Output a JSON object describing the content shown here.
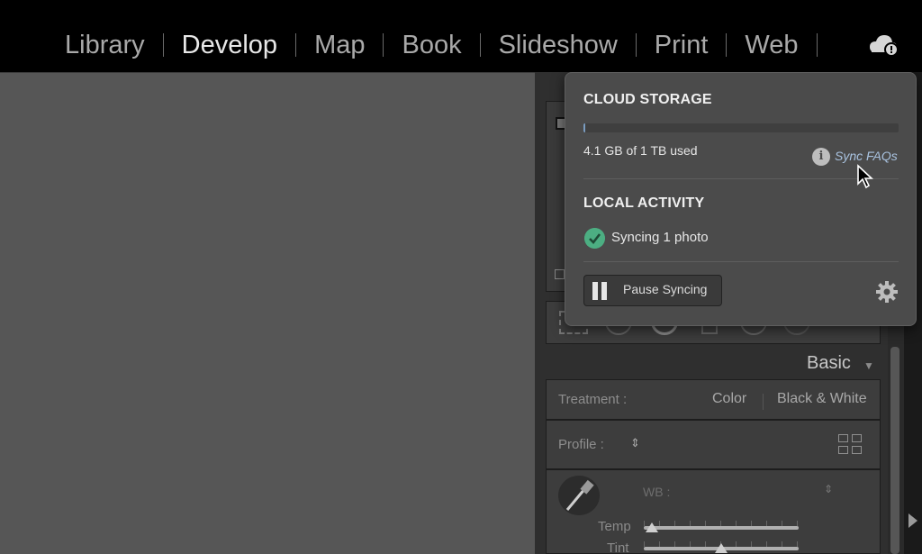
{
  "modules": {
    "items": [
      {
        "label": "Library"
      },
      {
        "label": "Develop"
      },
      {
        "label": "Map"
      },
      {
        "label": "Book"
      },
      {
        "label": "Slideshow"
      },
      {
        "label": "Print"
      },
      {
        "label": "Web"
      }
    ],
    "active": "Develop",
    "cloud_icon": "cloud-sync-icon"
  },
  "cloud_popup": {
    "storage_title": "CLOUD STORAGE",
    "usage_text": "4.1 GB of 1 TB used",
    "usage_fraction": 0.0041,
    "faq_link": "Sync FAQs",
    "activity_title": "LOCAL ACTIVITY",
    "sync_status": "Syncing 1 photo",
    "pause_button": "Pause Syncing",
    "icons": {
      "info": "info-icon",
      "status": "check-circle-icon",
      "pause": "pause-icon",
      "settings": "gear-icon"
    },
    "colors": {
      "status_green": "#4cae82",
      "link_blue": "#a9c3e0"
    }
  },
  "develop_panel": {
    "section_title": "Basic",
    "treatment": {
      "label": "Treatment :",
      "options": [
        "Color",
        "Black & White"
      ]
    },
    "profile": {
      "label": "Profile :"
    },
    "white_balance": {
      "label": "WB :"
    },
    "sliders": [
      {
        "label": "Temp",
        "value": 0.05
      },
      {
        "label": "Tint",
        "value": 0.5
      }
    ]
  }
}
